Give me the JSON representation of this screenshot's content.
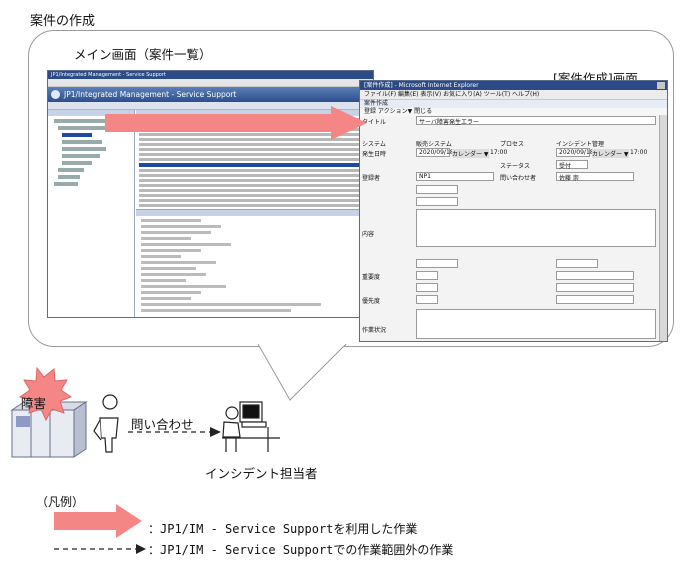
{
  "title": "案件の作成",
  "main_screen_label": "メイン画面（案件一覧）",
  "create_screen_label": "[案件作成]画面",
  "main_window": {
    "titlebar": "JP1/Integrated Management - Service Support",
    "banner": "JP1/Integrated Management - Service Support"
  },
  "create_window": {
    "titlebar": "[案件作成] - Microsoft Internet Explorer",
    "menu": "ファイル(F)  編集(E)  表示(V)  お気に入り(A)  ツール(T)  ヘルプ(H)",
    "header": "案件作成",
    "action": "登録  アクション▼  閉じる",
    "title_field_label": "タイトル",
    "title_field_value": "サーバ障害発生エラー",
    "system_label": "システム",
    "system_value": "販売システム",
    "process_label": "プロセス",
    "process_value": "インシデント管理",
    "occurrence_label": "発生日時",
    "registration_label": "登録者",
    "registration_value": "NP1",
    "inquirer_label": "問い合わせ者",
    "inquirer_value": "佐藤 崇",
    "date_value": "2020/09/18",
    "time_value": "17:00",
    "calendar_button": "カレンダー ▼",
    "status_label": "ステータス",
    "status_value": "受付",
    "severity_label": "重要度",
    "priority_label": "優先度",
    "content_label": "内容",
    "handling_label": "作業状況"
  },
  "incident_label": "障害",
  "inquiry_label": "問い合わせ",
  "person_label": "インシデント担当者",
  "legend": {
    "title": "（凡例）",
    "solid_arrow_text": "：JP1/IM - Service Supportを利用した作業",
    "dashed_arrow_text": "：JP1/IM - Service Supportでの作業範囲外の作業"
  },
  "colors": {
    "accent_arrow": "#f58686",
    "incident_burst": "#f58686",
    "window_titlebar": "#2b4a86"
  }
}
